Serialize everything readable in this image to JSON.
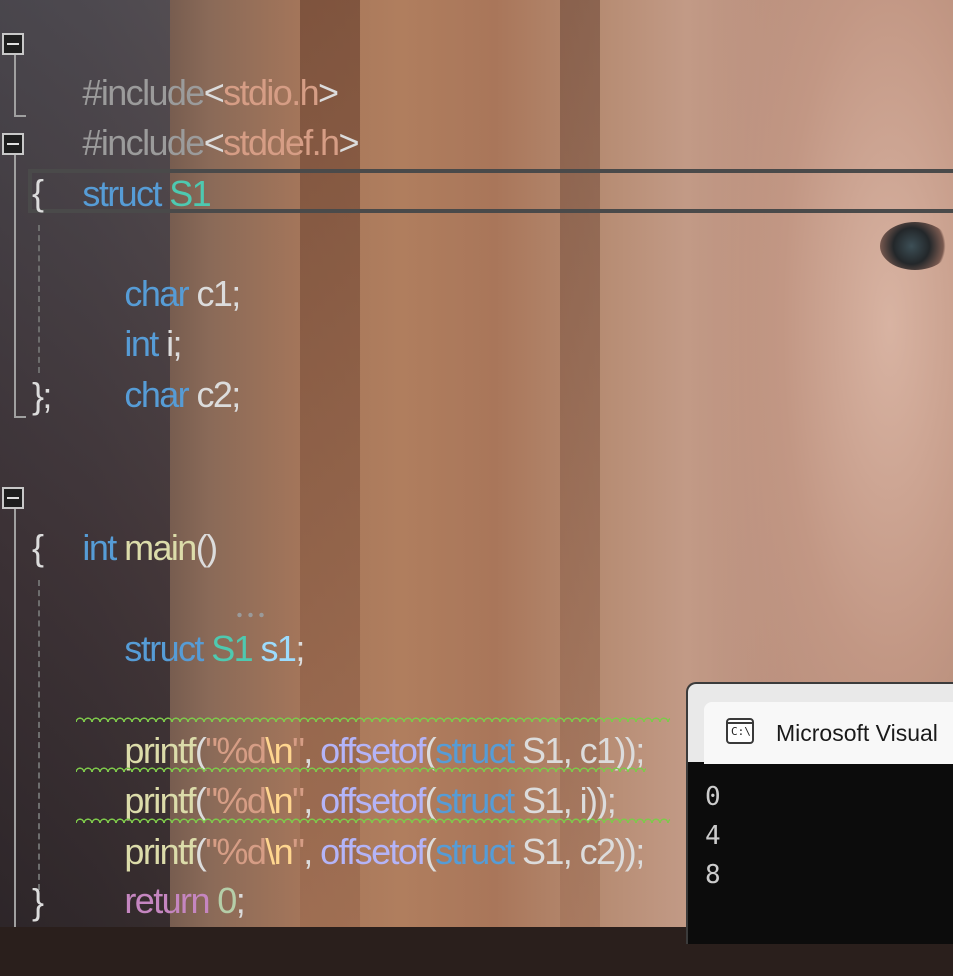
{
  "editor": {
    "lines": {
      "l1": {
        "hash": "#include",
        "lt": "<",
        "file": "stdio.h",
        "gt": ">"
      },
      "l2": {
        "hash": "#include",
        "lt": "<",
        "file": "stddef.h",
        "gt": ">"
      },
      "l3": {
        "kw": "struct",
        "name": "S1"
      },
      "l4": {
        "text": "{"
      },
      "l5": {
        "type": "char",
        "rest": "c1;"
      },
      "l6": {
        "type": "int",
        "rest": "i;"
      },
      "l7": {
        "type": "char",
        "rest": "c2;"
      },
      "l8": {
        "text": "};"
      },
      "l10": {
        "type": "int",
        "fn": "main",
        "rest": "()"
      },
      "l11": {
        "text": "{"
      },
      "l12": {
        "kw": "struct",
        "name": "S1",
        "var": "s1",
        "end": ";"
      },
      "l14": {
        "fn": "printf",
        "open": "(",
        "str": "\"%d",
        "esc": "\\n",
        "strend": "\"",
        "comma": ", ",
        "macro": "offsetof",
        "p2": "(",
        "kw": "struct",
        "sp": " ",
        "type": "S1",
        "member": ", c1",
        "close": "));"
      },
      "l15": {
        "fn": "printf",
        "open": "(",
        "str": "\"%d",
        "esc": "\\n",
        "strend": "\"",
        "comma": ", ",
        "macro": "offsetof",
        "p2": "(",
        "kw": "struct",
        "sp": " ",
        "type": "S1",
        "member": ", i",
        "close": "));"
      },
      "l16": {
        "fn": "printf",
        "open": "(",
        "str": "\"%d",
        "esc": "\\n",
        "strend": "\"",
        "comma": ", ",
        "macro": "offsetof",
        "p2": "(",
        "kw": "struct",
        "sp": " ",
        "type": "S1",
        "member": ", c2",
        "close": "));"
      },
      "l17": {
        "kw": "return",
        "num": "0",
        "end": ";"
      },
      "l18": {
        "text": "}"
      }
    }
  },
  "console": {
    "icon_label": "C:\\",
    "icon": "terminal-icon",
    "title": "Microsoft Visual",
    "output": [
      "0",
      "4",
      "8"
    ]
  },
  "colors": {
    "keyword": "#569cd6",
    "type": "#4ec9b0",
    "function": "#dcdcaa",
    "string": "#d69d85",
    "macro": "#b4b4f8",
    "control": "#c586c0",
    "squiggle": "#7ec94b"
  }
}
